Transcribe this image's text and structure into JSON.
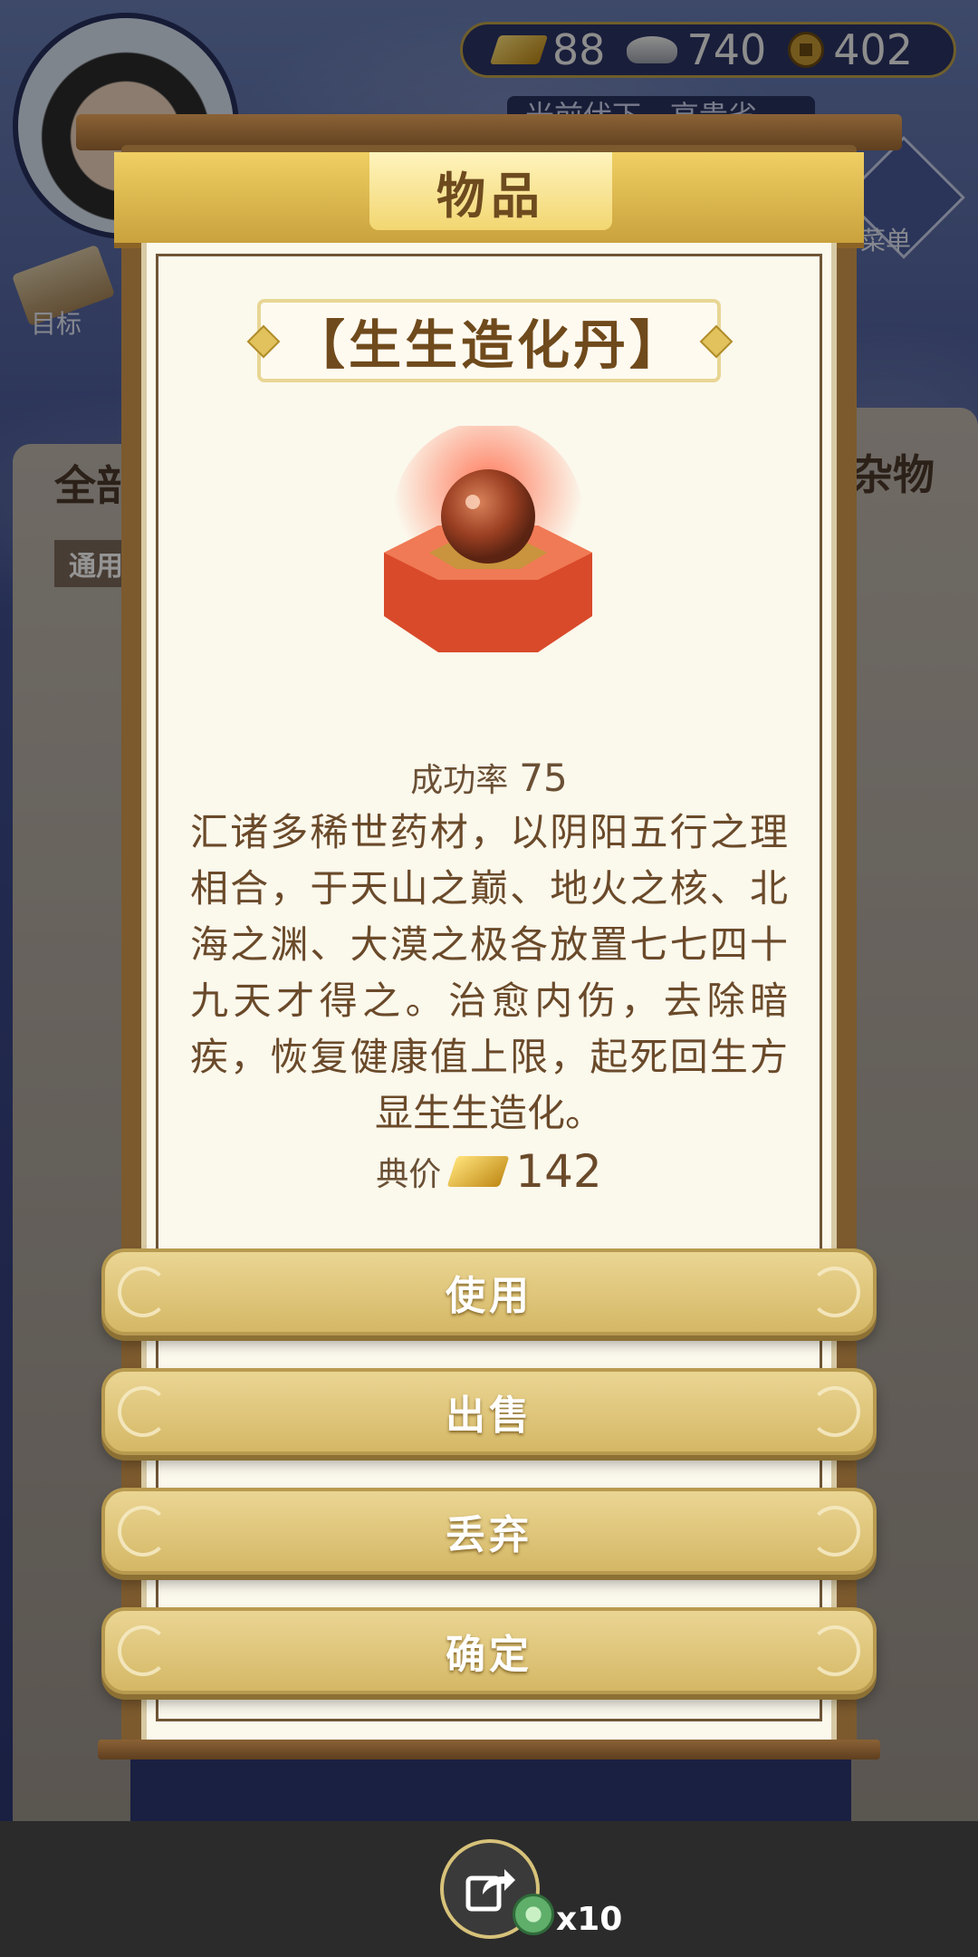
{
  "background": {
    "currency": {
      "gold": "88",
      "silver": "740",
      "coins": "402"
    },
    "top_strip_text": "光前伏下 - 高贵省",
    "menu_label": "菜单",
    "goal_label": "目标",
    "tab_all": "全部",
    "tab_misc": "杂物",
    "subtab_general": "通用"
  },
  "dialog": {
    "header_title": "物品",
    "item_name": "【生生造化丹】",
    "success_rate_label": "成功率",
    "success_rate_value": "75",
    "description": "汇诸多稀世药材，以阴阳五行之理相合，于天山之巅、地火之核、北海之渊、大漠之极各放置七七四十九天才得之。治愈内伤，去除暗疾，恢复健康值上限，起死回生方显生生造化。",
    "price_label": "典价",
    "price_value": "142",
    "buttons": {
      "use": "使用",
      "sell": "出售",
      "discard": "丢弃",
      "confirm": "确定"
    }
  },
  "bottom_bar": {
    "share_count": "x10"
  },
  "colors": {
    "gold_frame": "#e2c45c",
    "wood": "#7c5a2e",
    "paper": "#fbf8ec",
    "text_brown": "#6a4a2a"
  }
}
